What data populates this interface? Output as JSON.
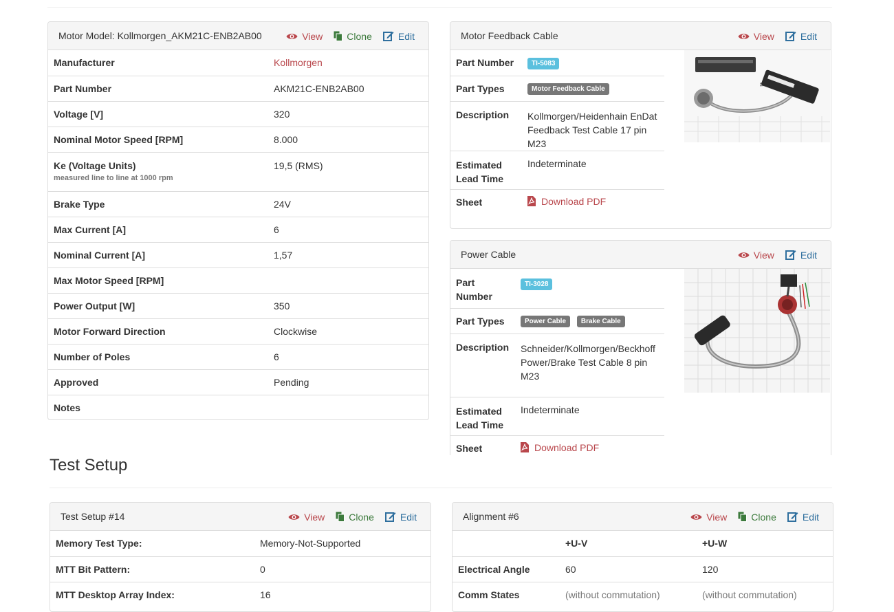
{
  "actions": {
    "view": "View",
    "clone": "Clone",
    "edit": "Edit"
  },
  "motor": {
    "title": "Motor Model: Kollmorgen_AKM21C-ENB2AB00",
    "rows": [
      {
        "key": "Manufacturer",
        "value": "Kollmorgen"
      },
      {
        "key": "Part Number",
        "value": "AKM21C-ENB2AB00"
      },
      {
        "key": "Voltage [V]",
        "value": "320"
      },
      {
        "key": "Nominal Motor Speed [RPM]",
        "value": "8.000"
      },
      {
        "key": "Ke (Voltage Units)",
        "sub": "measured line to line at 1000 rpm",
        "value": "19,5 (RMS)"
      },
      {
        "key": "Brake Type",
        "value": "24V"
      },
      {
        "key": "Max Current [A]",
        "value": "6"
      },
      {
        "key": "Nominal Current [A]",
        "value": "1,57"
      },
      {
        "key": "Max Motor Speed [RPM]",
        "value": ""
      },
      {
        "key": "Power Output [W]",
        "value": "350"
      },
      {
        "key": "Motor Forward Direction",
        "value": "Clockwise"
      },
      {
        "key": "Number of Poles",
        "value": "6"
      },
      {
        "key": "Approved",
        "value": "Pending"
      },
      {
        "key": "Notes",
        "value": ""
      }
    ]
  },
  "feedback_cable": {
    "title": "Motor Feedback Cable",
    "labels": {
      "part_number": "Part Number",
      "part_types": "Part Types",
      "description": "Description",
      "lead_time": "Estimated Lead Time",
      "sheet": "Sheet"
    },
    "part_number": "TI-5083",
    "part_types": [
      "Motor Feedback Cable"
    ],
    "description": "Kollmorgen/Heidenhain EnDat Feedback Test Cable 17 pin M23",
    "lead_time": "Indeterminate",
    "sheet_link": "Download PDF"
  },
  "power_cable": {
    "title": "Power Cable",
    "labels": {
      "part_number": "Part Number",
      "part_types": "Part Types",
      "description": "Description",
      "lead_time": "Estimated Lead Time",
      "sheet": "Sheet"
    },
    "part_number": "TI-3028",
    "part_types": [
      "Power Cable",
      "Brake Cable"
    ],
    "description": "Schneider/Kollmorgen/Beckhoff Power/Brake Test Cable 8 pin M23",
    "lead_time": "Indeterminate",
    "sheet_link": "Download PDF"
  },
  "test_setup_heading": "Test Setup",
  "test_setup": {
    "title": "Test Setup #14",
    "rows": [
      {
        "key": "Memory Test Type:",
        "value": "Memory-Not-Supported"
      },
      {
        "key": "MTT Bit Pattern:",
        "value": "0"
      },
      {
        "key": "MTT Desktop Array Index:",
        "value": "16"
      }
    ]
  },
  "alignment": {
    "title": "Alignment #6",
    "columns": [
      "",
      "+U-V",
      "+U-W"
    ],
    "rows": [
      {
        "label": "Electrical Angle",
        "uv": "60",
        "uw": "120"
      },
      {
        "label": "Comm States",
        "uv": "(without commutation)",
        "uw": "(without commutation)"
      }
    ]
  },
  "colors": {
    "view": "#b9474c",
    "clone": "#3c7a3c",
    "edit": "#2f6f9e",
    "part_number_badge": "#5bc0de",
    "type_badge": "#777777"
  },
  "icons": [
    "eye-icon",
    "copy-icon",
    "edit-icon",
    "pdf-icon"
  ]
}
